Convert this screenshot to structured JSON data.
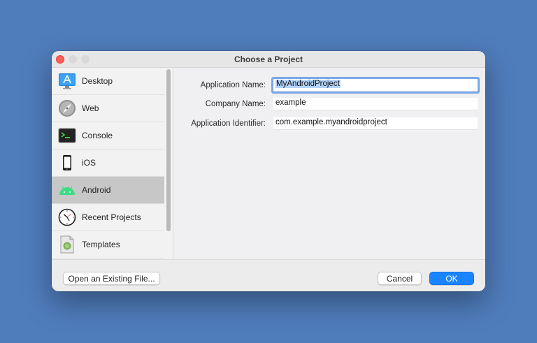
{
  "window": {
    "title": "Choose a Project"
  },
  "sidebar": {
    "items": [
      {
        "label": "Desktop",
        "icon": "desktop-app-icon"
      },
      {
        "label": "Web",
        "icon": "web-compass-icon"
      },
      {
        "label": "Console",
        "icon": "terminal-icon"
      },
      {
        "label": "iOS",
        "icon": "iphone-icon"
      },
      {
        "label": "Android",
        "icon": "android-icon",
        "selected": true
      },
      {
        "label": "Recent Projects",
        "icon": "clock-icon"
      },
      {
        "label": "Templates",
        "icon": "template-icon"
      }
    ]
  },
  "form": {
    "app_name_label": "Application Name:",
    "app_name_value": "MyAndroidProject",
    "company_label": "Company Name:",
    "company_value": "example",
    "identifier_label": "Application Identifier:",
    "identifier_value": "com.example.myandroidproject"
  },
  "footer": {
    "open_existing_label": "Open an Existing File...",
    "cancel_label": "Cancel",
    "ok_label": "OK"
  },
  "colors": {
    "background": "#4f7cbb",
    "accent": "#1a84ff",
    "close": "#fe5f57",
    "android_green": "#3ddc84"
  }
}
